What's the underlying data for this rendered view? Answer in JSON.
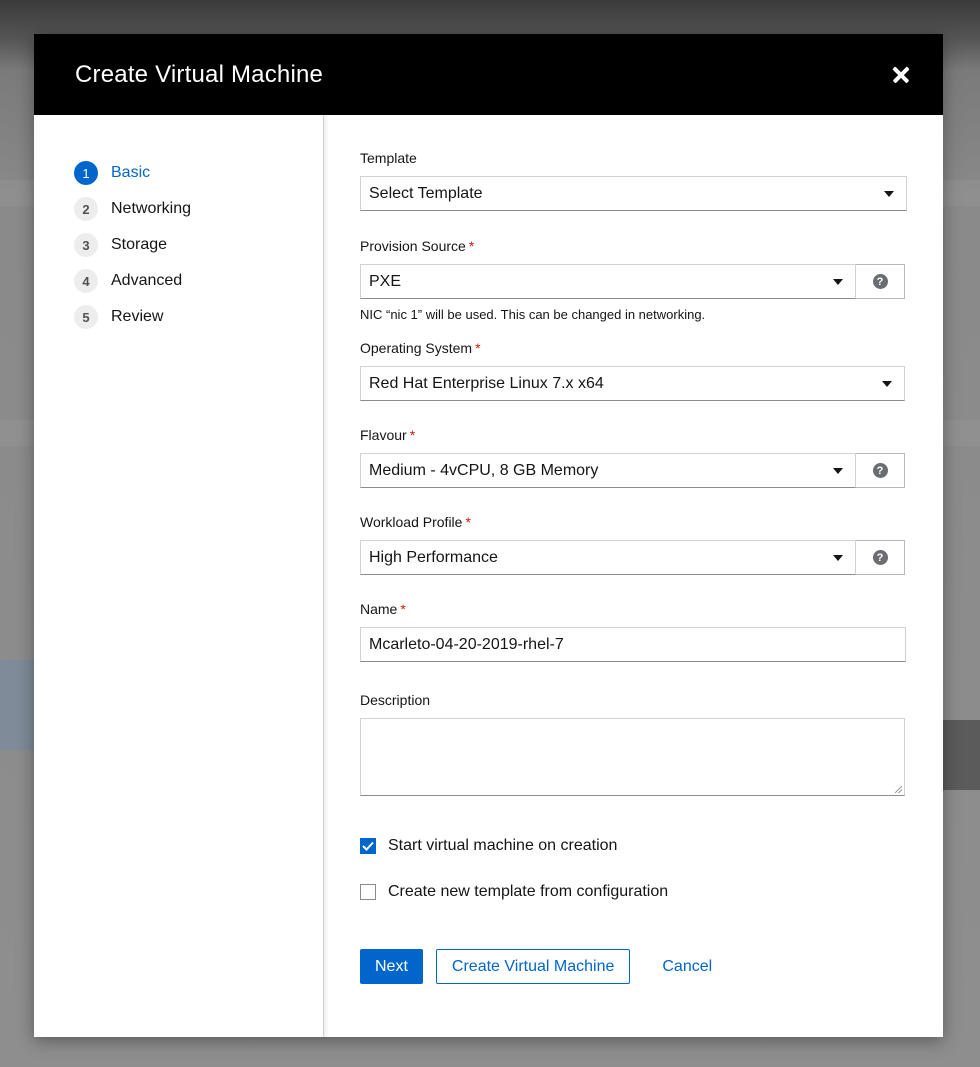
{
  "modal": {
    "title": "Create Virtual Machine"
  },
  "wizard_steps": [
    {
      "number": "1",
      "label": "Basic",
      "active": true
    },
    {
      "number": "2",
      "label": "Networking",
      "active": false
    },
    {
      "number": "3",
      "label": "Storage",
      "active": false
    },
    {
      "number": "4",
      "label": "Advanced",
      "active": false
    },
    {
      "number": "5",
      "label": "Review",
      "active": false
    }
  ],
  "form": {
    "template": {
      "label": "Template",
      "value": "Select Template"
    },
    "provision_source": {
      "label": "Provision Source",
      "required_mark": "*",
      "value": "PXE",
      "helper": "NIC “nic 1” will be used. This can be changed in networking."
    },
    "operating_system": {
      "label": "Operating System",
      "required_mark": "*",
      "value": "Red Hat Enterprise Linux 7.x x64"
    },
    "flavour": {
      "label": "Flavour",
      "required_mark": "*",
      "value": "Medium - 4vCPU, 8 GB Memory"
    },
    "workload_profile": {
      "label": "Workload Profile",
      "required_mark": "*",
      "value": "High Performance"
    },
    "name": {
      "label": "Name",
      "required_mark": "*",
      "value": "Mcarleto-04-20-2019-rhel-7"
    },
    "description": {
      "label": "Description",
      "value": ""
    },
    "start_on_creation": {
      "label": "Start virtual machine on creation",
      "checked": true
    },
    "create_template": {
      "label": "Create new template from configuration",
      "checked": false
    }
  },
  "help_glyph": "?",
  "footer": {
    "next_label": "Next",
    "create_label": "Create Virtual Machine",
    "cancel_label": "Cancel"
  },
  "colors": {
    "accent": "#0066cc",
    "header_bg": "#000000",
    "required": "#c9190b"
  }
}
